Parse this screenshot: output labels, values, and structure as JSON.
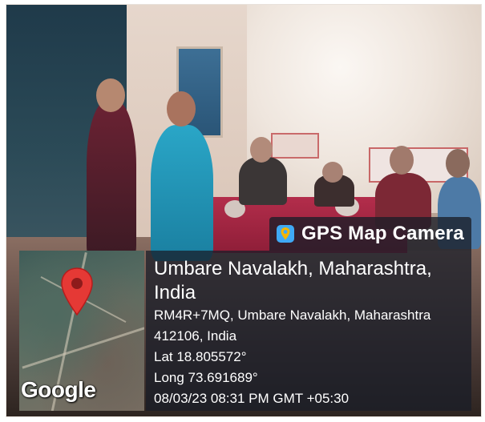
{
  "badge": {
    "icon": "map-pin-app-icon",
    "title": "GPS Map Camera"
  },
  "location": {
    "title": "Umbare Navalakh, Maharashtra, India",
    "address_line1": "RM4R+7MQ, Umbare Navalakh, Maharashtra",
    "address_line2": "412106, India",
    "lat": "Lat 18.805572°",
    "long": "Long 73.691689°",
    "datetime": "08/03/23 08:31 PM GMT +05:30"
  },
  "map": {
    "label": "Google",
    "marker_color": "#e53935"
  }
}
